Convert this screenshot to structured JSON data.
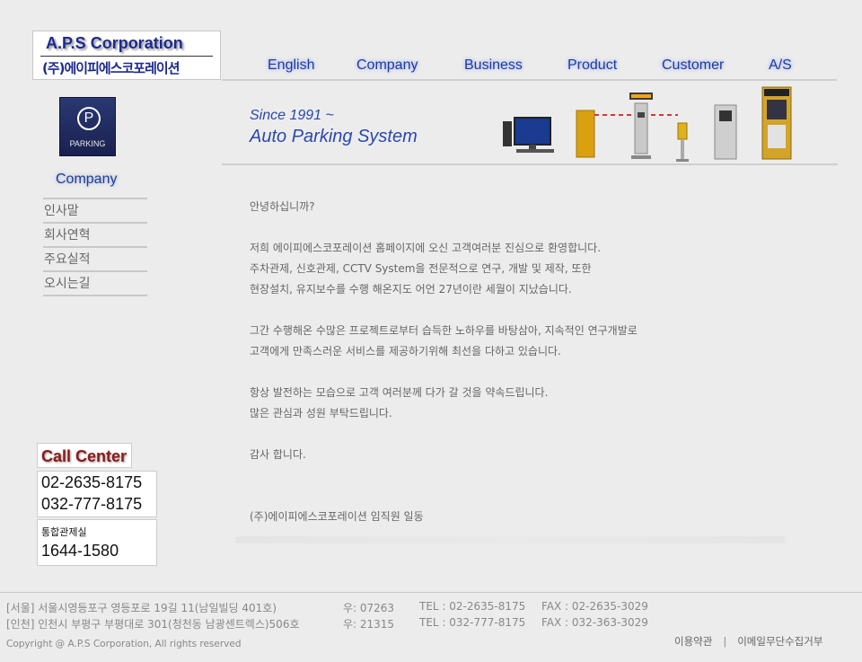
{
  "logo": {
    "en": "A.P.S Corporation",
    "ko": "(주)에이피에스코포레이션"
  },
  "nav": [
    "English",
    "Company",
    "Business",
    "Product",
    "Customer",
    "A/S"
  ],
  "sidebar": {
    "icon_text": "PARKING",
    "icon_letter": "P",
    "title": "Company",
    "items": [
      "인사말",
      "회사연혁",
      "주요실적",
      "오시는길"
    ]
  },
  "banner": {
    "since": "Since 1991 ~",
    "tagline": "Auto Parking System"
  },
  "content": {
    "greeting": "안녕하십니까?",
    "para1": [
      "저희 에이피에스코포레이션 홈페이지에 오신 고객여러분 진심으로 환영합니다.",
      "주차관제, 신호관제, CCTV System을 전문적으로 연구, 개발 및 제작, 또한",
      "현장설치, 유지보수를 수행 해온지도 어언 27년이란 세월이 지났습니다."
    ],
    "para2": [
      "그간 수행해온 수많은 프로젝트로부터 습득한 노하우를 바탕삼아, 지속적인 연구개발로",
      "고객에게 만족스러운 서비스를 제공하기위해 최선을 다하고 있습니다."
    ],
    "para3": [
      "항상 발전하는 모습으로 고객 여러분께 다가 갈 것을 약속드립니다.",
      "많은 관심과 성원 부탁드립니다."
    ],
    "thanks": "감사 합니다.",
    "signature": "(주)에이피에스코포레이션 임직원 일동"
  },
  "callcenter": {
    "title": "Call Center",
    "phone1": "02-2635-8175",
    "phone2": "032-777-8175",
    "control_label": "통합관제실",
    "control_phone": "1644-1580"
  },
  "footer": {
    "seoul": {
      "addr": "[서울] 서울시영등포구 영등포로 19길 11(남일빌딩 401호)",
      "zip": "우: 07263",
      "tel": "TEL : 02-2635-8175",
      "fax": "FAX : 02-2635-3029"
    },
    "incheon": {
      "addr": "[인천] 인천시 부평구 부평대로 301(청천동 남광센트렉스)506호",
      "zip": "우: 21315",
      "tel": "TEL : 032-777-8175",
      "fax": "FAX : 032-363-3029"
    },
    "copyright": "Copyright @ A.P.S Corporation, All rights reserved",
    "terms": "이용약관",
    "email_policy": "이메일무단수집거부"
  }
}
